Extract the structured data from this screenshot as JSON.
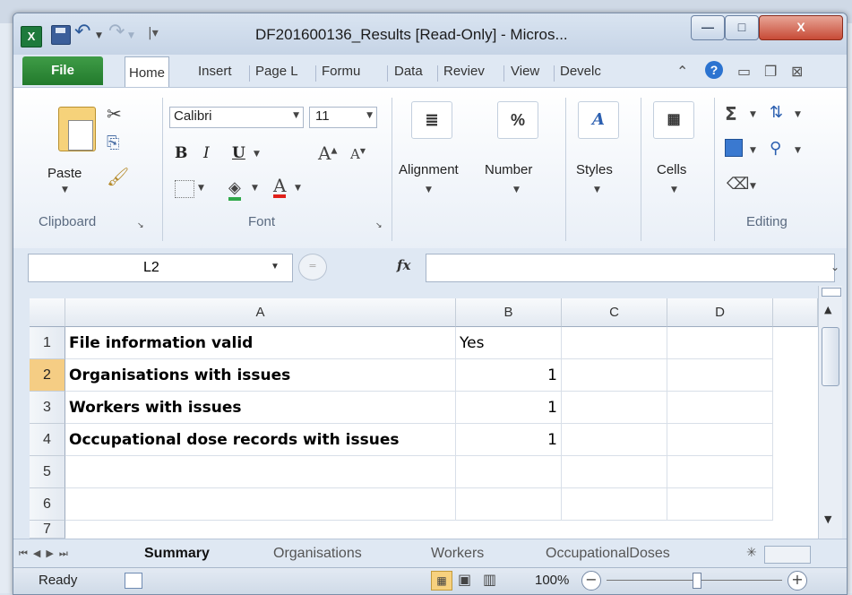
{
  "window": {
    "title": "DF201600136_Results  [Read-Only]  -  Micros...",
    "min_label": "—",
    "max_label": "□",
    "close_label": "X"
  },
  "ribbon_tabs": [
    "File",
    "Home",
    "Insert",
    "Page L",
    "Formu",
    "Data",
    "Reviev",
    "View",
    "Develc"
  ],
  "clipboard": {
    "paste_label": "Paste",
    "group_label": "Clipboard"
  },
  "font": {
    "name": "Calibri",
    "size": "11",
    "group_label": "Font",
    "bold": "B",
    "italic": "I",
    "underline": "U"
  },
  "alignment": {
    "label": "Alignment"
  },
  "number": {
    "label": "Number",
    "icon_text": "%"
  },
  "styles": {
    "label": "Styles"
  },
  "cells": {
    "label": "Cells"
  },
  "editing": {
    "label": "Editing",
    "sum": "Σ"
  },
  "formula_bar": {
    "name_box": "L2",
    "fx": "fx",
    "formula": ""
  },
  "columns": [
    "A",
    "B",
    "C",
    "D"
  ],
  "rows": [
    {
      "num": "1",
      "a": "File information valid",
      "b": "Yes"
    },
    {
      "num": "2",
      "a": "Organisations with issues",
      "b": "1"
    },
    {
      "num": "3",
      "a": "Workers with issues",
      "b": "1"
    },
    {
      "num": "4",
      "a": "Occupational dose records with issues",
      "b": "1"
    },
    {
      "num": "5",
      "a": "",
      "b": ""
    },
    {
      "num": "6",
      "a": "",
      "b": ""
    },
    {
      "num": "7",
      "a": "",
      "b": ""
    }
  ],
  "sheet_tabs": [
    "Summary",
    "Organisations",
    "Workers",
    "OccupationalDoses"
  ],
  "status": {
    "ready": "Ready",
    "zoom": "100%",
    "minus": "−",
    "plus": "+"
  },
  "colors": {
    "file_tab": "#2e8a37",
    "selected_row_header": "#f5cd84",
    "accent": "#2b73d0"
  }
}
